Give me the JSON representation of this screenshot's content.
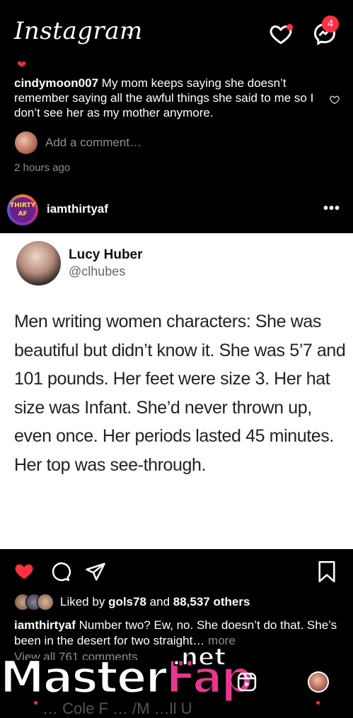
{
  "header": {
    "app_title": "Instagram",
    "notification_count": "4",
    "colors": {
      "badge": "#ff3040"
    }
  },
  "comment": {
    "username": "cindymoon007",
    "text": "My mom keeps saying she doesn’t remember saying all the awful things she said to me so I don’t see her as my mother anymore.",
    "add_comment_placeholder": "Add a comment…",
    "time_ago": "2 hours ago"
  },
  "post": {
    "username": "iamthirtyaf",
    "avatar_text": "THIRTY AF",
    "more_label": "•••",
    "tweet": {
      "name": "Lucy Huber",
      "handle": "@clhubes",
      "text": "Men writing women characters: She was beautiful but didn’t know it. She was 5’7 and 101 pounds. Her feet were size 3. Her hat size was Infant. She’d never thrown up, even once. Her periods lasted 45 minutes. Her top was see-through."
    },
    "likes_prefix": "Liked by",
    "likes_user": "gols78",
    "likes_and": "and",
    "likes_others": "88,537 others",
    "caption_user": "iamthirtyaf",
    "caption_text": "Number two? Ew, no. She doesn’t do that. She’s been in the desert for two straight…",
    "caption_more": "more",
    "view_all_comments": "View all 761 comments"
  },
  "watermark": {
    "part1": "Master",
    "part2": "Fap",
    "suffix": ".net"
  },
  "bottom_peek": "… Cole F … /M …ll U"
}
